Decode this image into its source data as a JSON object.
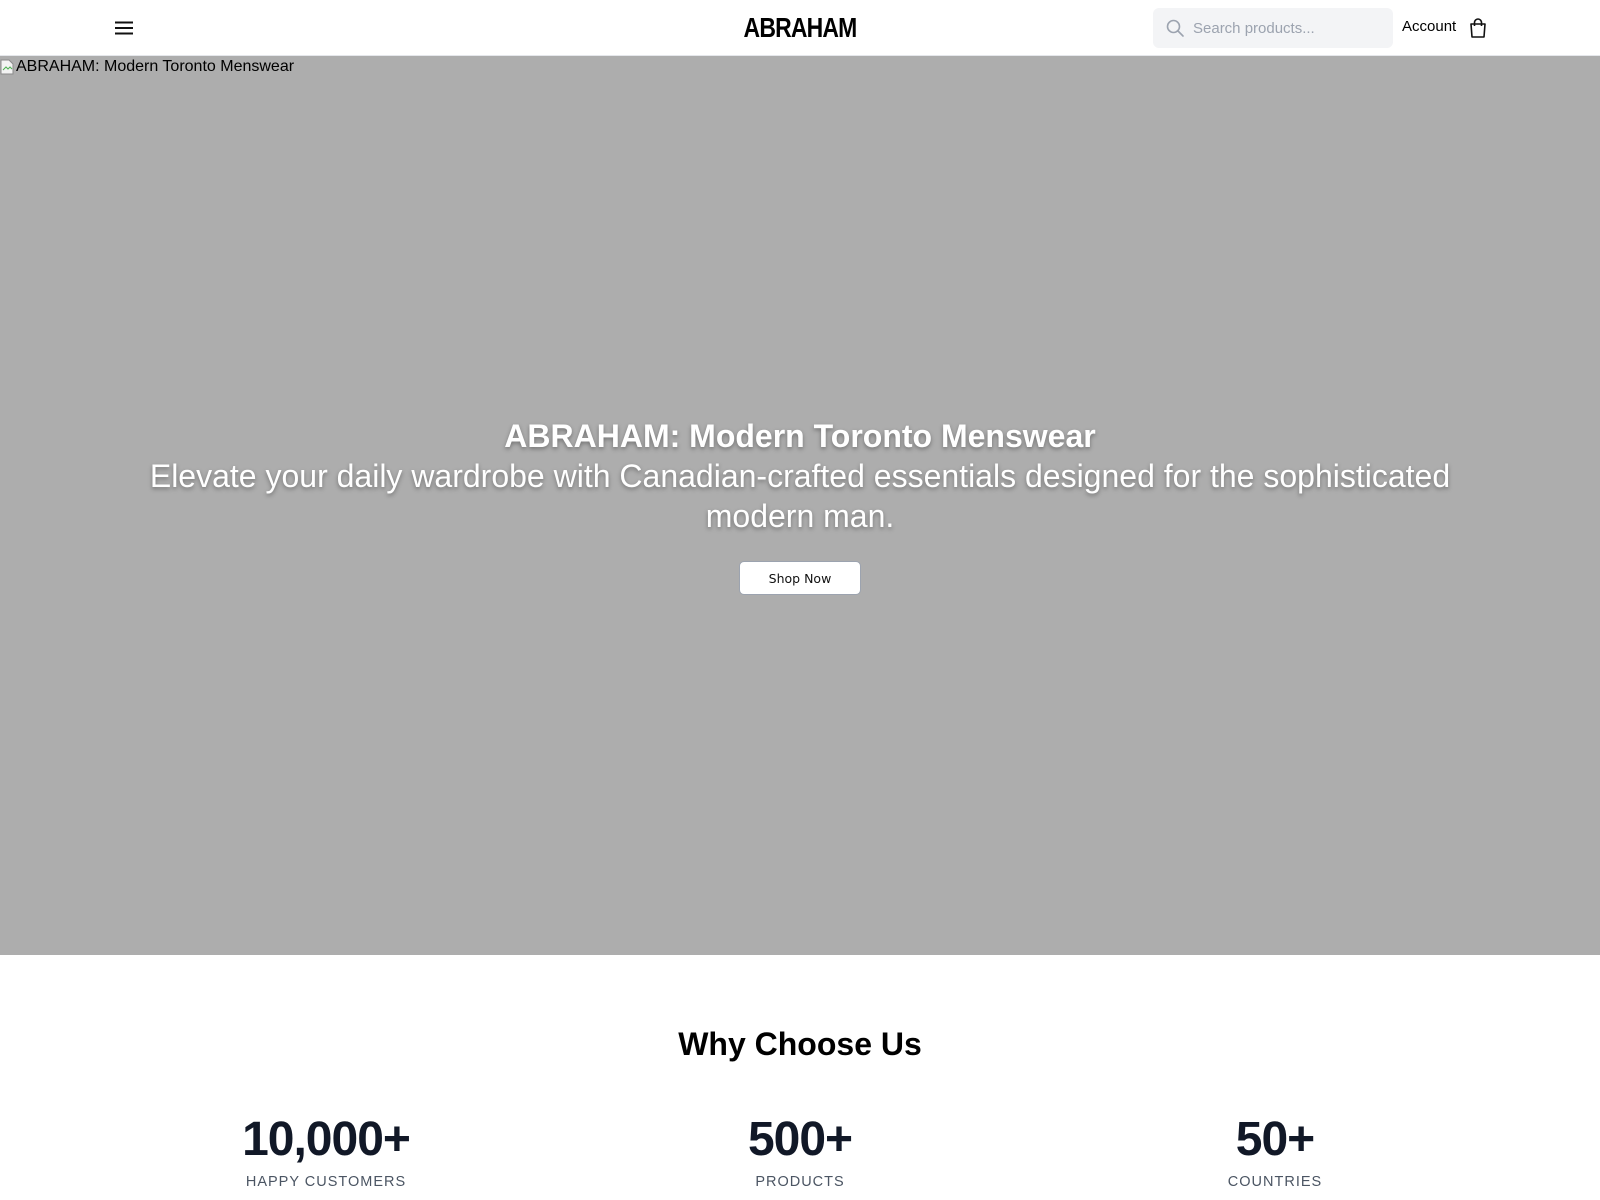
{
  "header": {
    "logo_text": "ABRAHAM",
    "search": {
      "placeholder": "Search products...",
      "value": ""
    },
    "account_label": "Account",
    "icons": {
      "menu": "hamburger-menu-icon",
      "search": "search-icon",
      "cart": "shopping-bag-icon"
    }
  },
  "hero": {
    "image_alt": "ABRAHAM: Modern Toronto Menswear",
    "title": "ABRAHAM: Modern Toronto Menswear",
    "subtitle": "Elevate your daily wardrobe with Canadian-crafted essentials designed for the sophisticated modern man.",
    "cta_label": "Shop Now",
    "background_color": "#adadad"
  },
  "why": {
    "title": "Why Choose Us",
    "stats": [
      {
        "number": "10,000+",
        "label": "HAPPY CUSTOMERS"
      },
      {
        "number": "500+",
        "label": "PRODUCTS"
      },
      {
        "number": "50+",
        "label": "COUNTRIES"
      }
    ]
  }
}
